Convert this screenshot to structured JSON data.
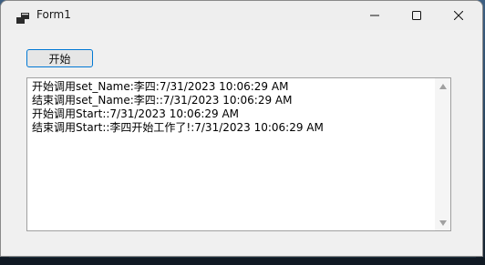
{
  "window": {
    "title": "Form1",
    "controls": {
      "minimize_icon": "minimize-icon",
      "maximize_icon": "maximize-icon",
      "close_icon": "close-icon"
    }
  },
  "form": {
    "start_button_label": "开始",
    "output_lines": [
      "开始调用set_Name:李四:7/31/2023 10:06:29 AM",
      "结束调用set_Name:李四::7/31/2023 10:06:29 AM",
      "开始调用Start::7/31/2023 10:06:29 AM",
      "结束调用Start::李四开始工作了!:7/31/2023 10:06:29 AM"
    ]
  },
  "colors": {
    "accent": "#0078d4",
    "window_bg": "#f0f0f0",
    "textbox_bg": "#ffffff"
  }
}
